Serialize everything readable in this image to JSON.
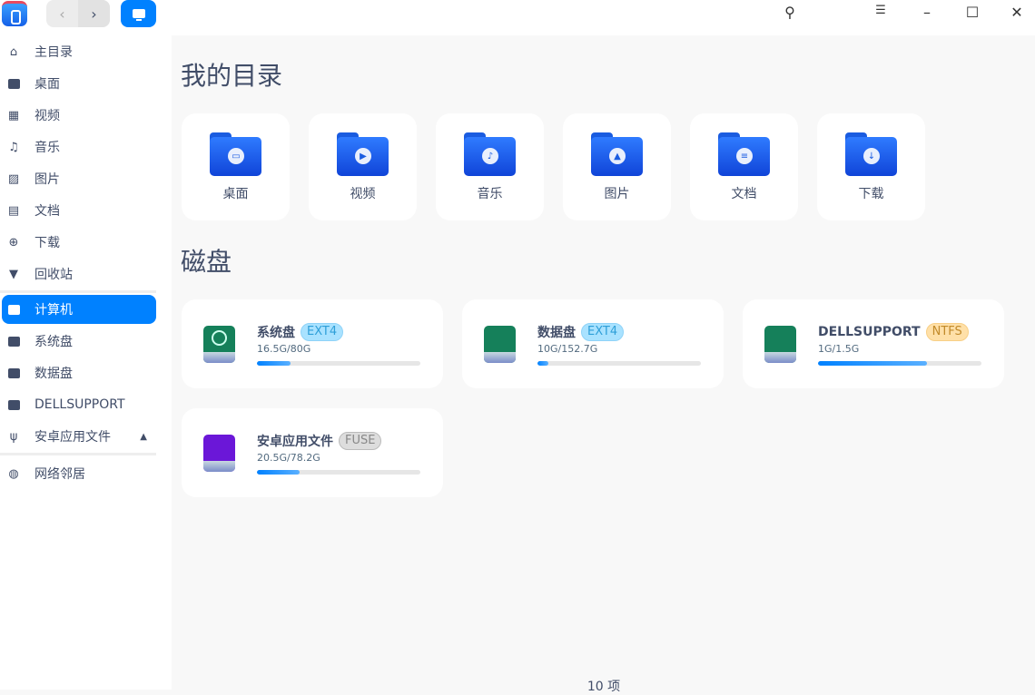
{
  "toolbar": {
    "back": "‹",
    "forward": "›",
    "search": "⚲",
    "menu": "☰",
    "minimize": "–",
    "maximize": "☐",
    "close": "✕"
  },
  "sidebar": {
    "items": [
      {
        "label": "主目录",
        "icon": "home-icon"
      },
      {
        "label": "桌面",
        "icon": "desktop-icon"
      },
      {
        "label": "视频",
        "icon": "video-icon"
      },
      {
        "label": "音乐",
        "icon": "music-icon"
      },
      {
        "label": "图片",
        "icon": "picture-icon"
      },
      {
        "label": "文档",
        "icon": "document-icon"
      },
      {
        "label": "下载",
        "icon": "download-icon"
      },
      {
        "label": "回收站",
        "icon": "trash-icon"
      },
      {
        "label": "计算机",
        "icon": "computer-icon"
      },
      {
        "label": "系统盘",
        "icon": "disk-icon"
      },
      {
        "label": "数据盘",
        "icon": "disk-icon"
      },
      {
        "label": "DELLSUPPORT",
        "icon": "disk-icon"
      },
      {
        "label": "安卓应用文件",
        "icon": "usb-icon"
      },
      {
        "label": "网络邻居",
        "icon": "network-icon"
      }
    ]
  },
  "main": {
    "dirs_title": "我的目录",
    "dirs": [
      "桌面",
      "视频",
      "音乐",
      "图片",
      "文档",
      "下载"
    ],
    "disks_title": "磁盘",
    "disks": [
      {
        "name": "系统盘",
        "fs": "EXT4",
        "size": "16.5G/80G",
        "usage": 0.206,
        "color": "#15805a"
      },
      {
        "name": "数据盘",
        "fs": "EXT4",
        "size": "10G/152.7G",
        "usage": 0.065,
        "color": "#15805a"
      },
      {
        "name": "DELLSUPPORT",
        "fs": "NTFS",
        "size": "1G/1.5G",
        "usage": 0.667,
        "color": "#15805a"
      },
      {
        "name": "安卓应用文件",
        "fs": "FUSE",
        "size": "20.5G/78.2G",
        "usage": 0.262,
        "color": "#6b17d8"
      }
    ]
  },
  "status": {
    "count": "10 项"
  },
  "colors": {
    "accent": "#0081ff"
  }
}
